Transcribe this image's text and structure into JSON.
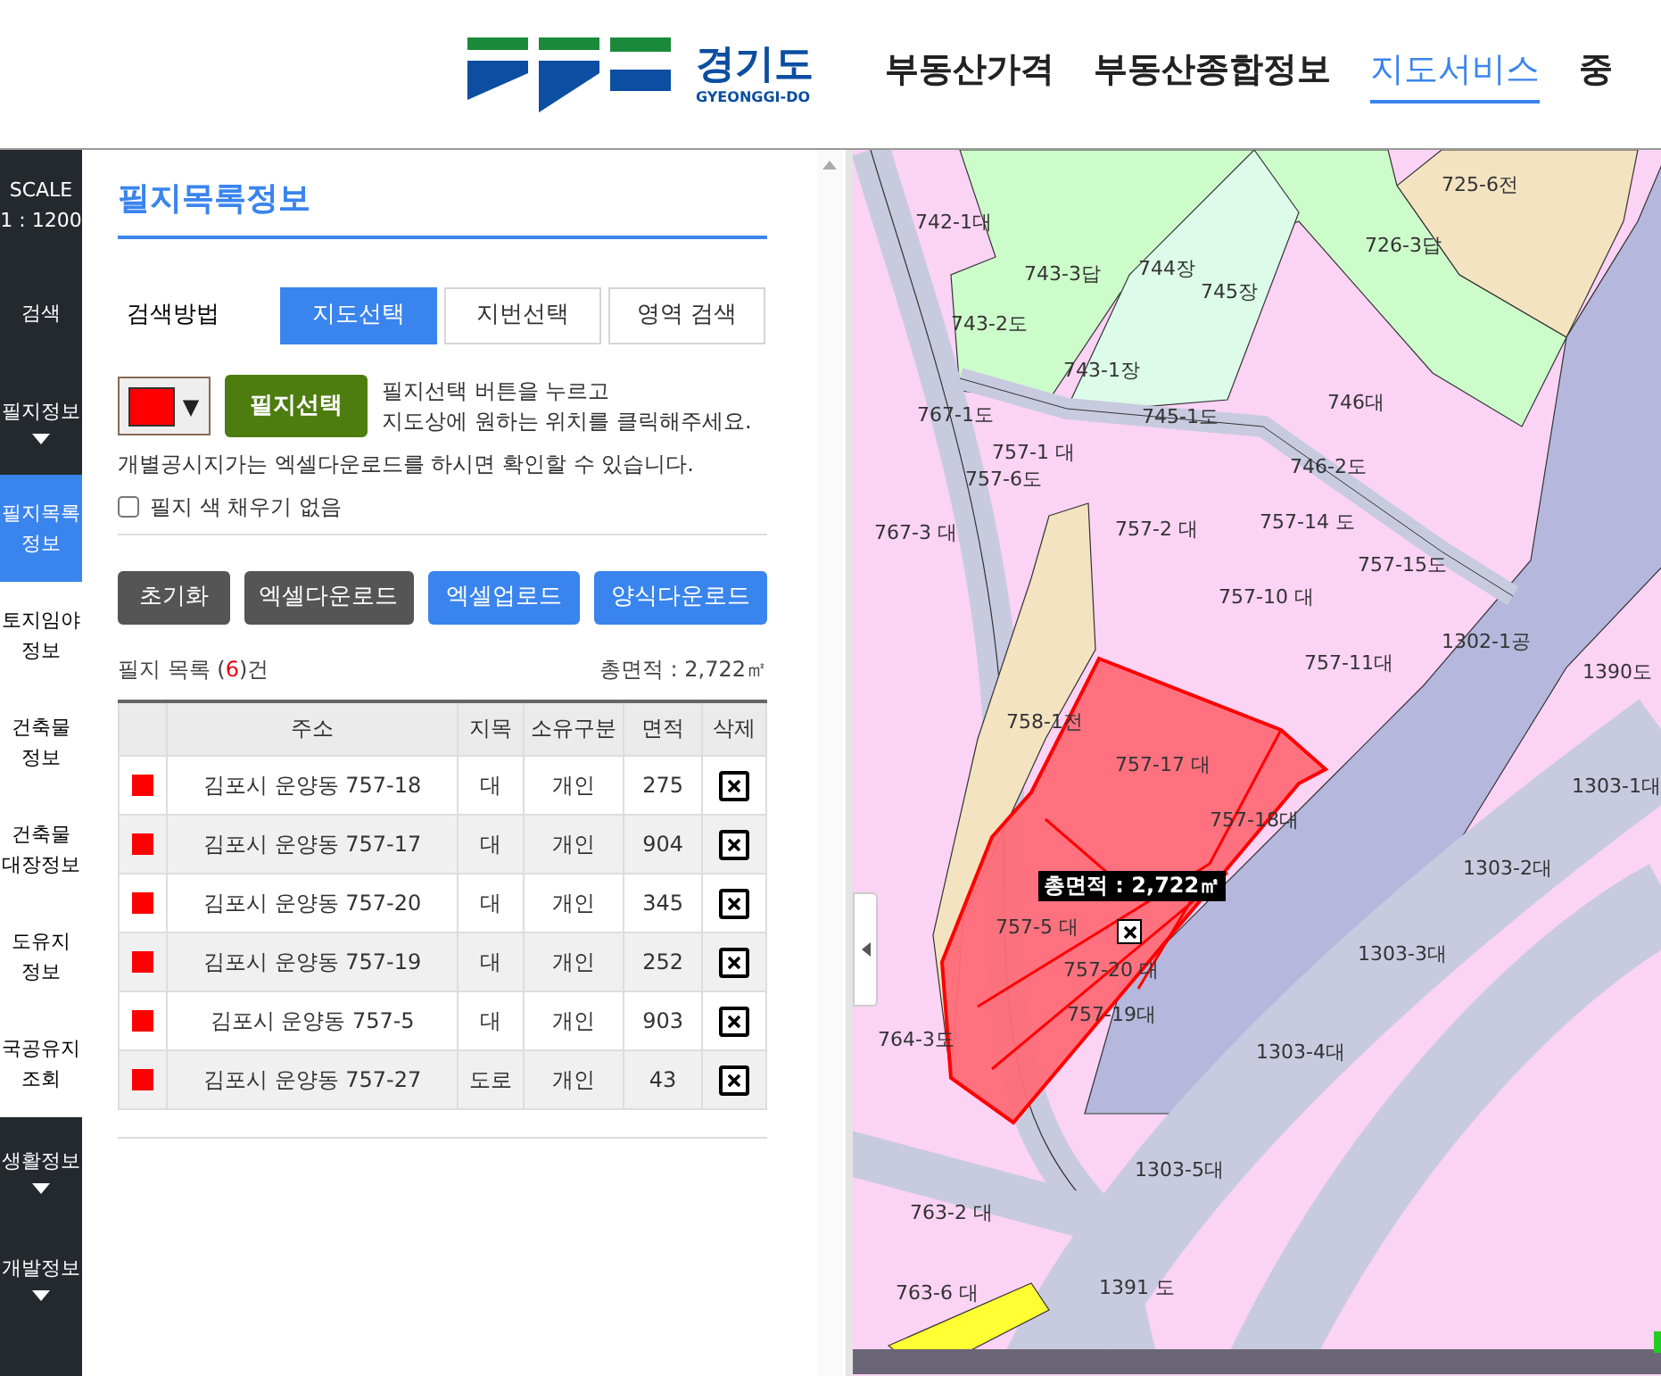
{
  "header": {
    "logo": {
      "name": "경기도",
      "subtitle": "GYEONGGI-DO"
    },
    "nav": [
      {
        "label": "부동산가격",
        "selected": false
      },
      {
        "label": "부동산종합정보",
        "selected": false
      },
      {
        "label": "지도서비스",
        "selected": true
      },
      {
        "label": "중",
        "selected": false
      }
    ]
  },
  "sidebar": {
    "items": [
      {
        "kind": "scale",
        "label": "SCALE",
        "value": "1 : 1200"
      },
      {
        "kind": "section",
        "label": "검색"
      },
      {
        "kind": "group",
        "label": "필지정보",
        "expanded": false
      },
      {
        "kind": "item",
        "label": "필지목록 정보",
        "selected": true
      },
      {
        "kind": "item",
        "label": "토지임야 정보",
        "selected": false
      },
      {
        "kind": "item",
        "label": "건축물 정보",
        "selected": false
      },
      {
        "kind": "item",
        "label": "건축물 대장정보",
        "selected": false
      },
      {
        "kind": "item",
        "label": "도유지 정보",
        "selected": false
      },
      {
        "kind": "item",
        "label": "국공유지 조회",
        "selected": false
      },
      {
        "kind": "group",
        "label": "생활정보",
        "expanded": false
      },
      {
        "kind": "group",
        "label": "개발정보",
        "expanded": false
      }
    ]
  },
  "panel": {
    "title": "필지목록정보",
    "search_method": {
      "label": "검색방법",
      "tabs": [
        {
          "label": "지도선택",
          "selected": true
        },
        {
          "label": "지번선택",
          "selected": false
        },
        {
          "label": "영역 검색",
          "selected": false
        }
      ]
    },
    "color_picker": {
      "color": "#ff0000",
      "caret": "▼"
    },
    "select_button": "필지선택",
    "instructions": [
      "필지선택 버튼을 누르고",
      "지도상에 원하는 위치를 클릭해주세요."
    ],
    "notice": "개별공시지가는 엑셀다운로드를 하시면 확인할 수 있습니다.",
    "no_fill": {
      "label": "필지 색 채우기 없음",
      "checked": false
    },
    "buttons": [
      {
        "label": "초기화",
        "kind": "dark"
      },
      {
        "label": "엑셀다운로드",
        "kind": "dark"
      },
      {
        "label": "엑셀업로드",
        "kind": "primary"
      },
      {
        "label": "양식다운로드",
        "kind": "primary"
      }
    ],
    "list_count": {
      "before": "필지 목록 (",
      "count": "6",
      "after": ")건"
    },
    "total_area": "총면적 : 2,722㎡",
    "table": {
      "columns": [
        "주소",
        "지목",
        "소유구분",
        "면적",
        "삭제"
      ],
      "rows": [
        {
          "color": "#ff0000",
          "address": "김포시 운양동 757-18",
          "land_type": "대",
          "ownership": "개인",
          "area": "275"
        },
        {
          "color": "#ff0000",
          "address": "김포시 운양동 757-17",
          "land_type": "대",
          "ownership": "개인",
          "area": "904"
        },
        {
          "color": "#ff0000",
          "address": "김포시 운양동 757-20",
          "land_type": "대",
          "ownership": "개인",
          "area": "345"
        },
        {
          "color": "#ff0000",
          "address": "김포시 운양동 757-19",
          "land_type": "대",
          "ownership": "개인",
          "area": "252"
        },
        {
          "color": "#ff0000",
          "address": "김포시 운양동 757-5",
          "land_type": "대",
          "ownership": "개인",
          "area": "903"
        },
        {
          "color": "#ff0000",
          "address": "김포시 운양동 757-27",
          "land_type": "도로",
          "ownership": "개인",
          "area": "43"
        }
      ]
    }
  },
  "map": {
    "labels": [
      "725-6전",
      "726-3답",
      "742-1대",
      "743-3답",
      "744장",
      "745장",
      "743-2도",
      "743-1장",
      "746대",
      "767-1도",
      "745-1도",
      "757-1 대",
      "757-6도",
      "746-2도",
      "767-3 대",
      "757-2 대",
      "757-14 도",
      "757-10 대",
      "757-15도",
      "1302-1공",
      "757-11대",
      "1390도",
      "758-1전",
      "757-17 대",
      "1303-1대",
      "757-18대",
      "1303-2대",
      "757-5 대",
      "757-20 대",
      "1303-3대",
      "757-19대",
      "764-3도",
      "1303-4대",
      "1303-5대",
      "763-2 대",
      "1391 도",
      "763-6 대"
    ],
    "total_area_label": "총면적 : 2,722㎡"
  }
}
